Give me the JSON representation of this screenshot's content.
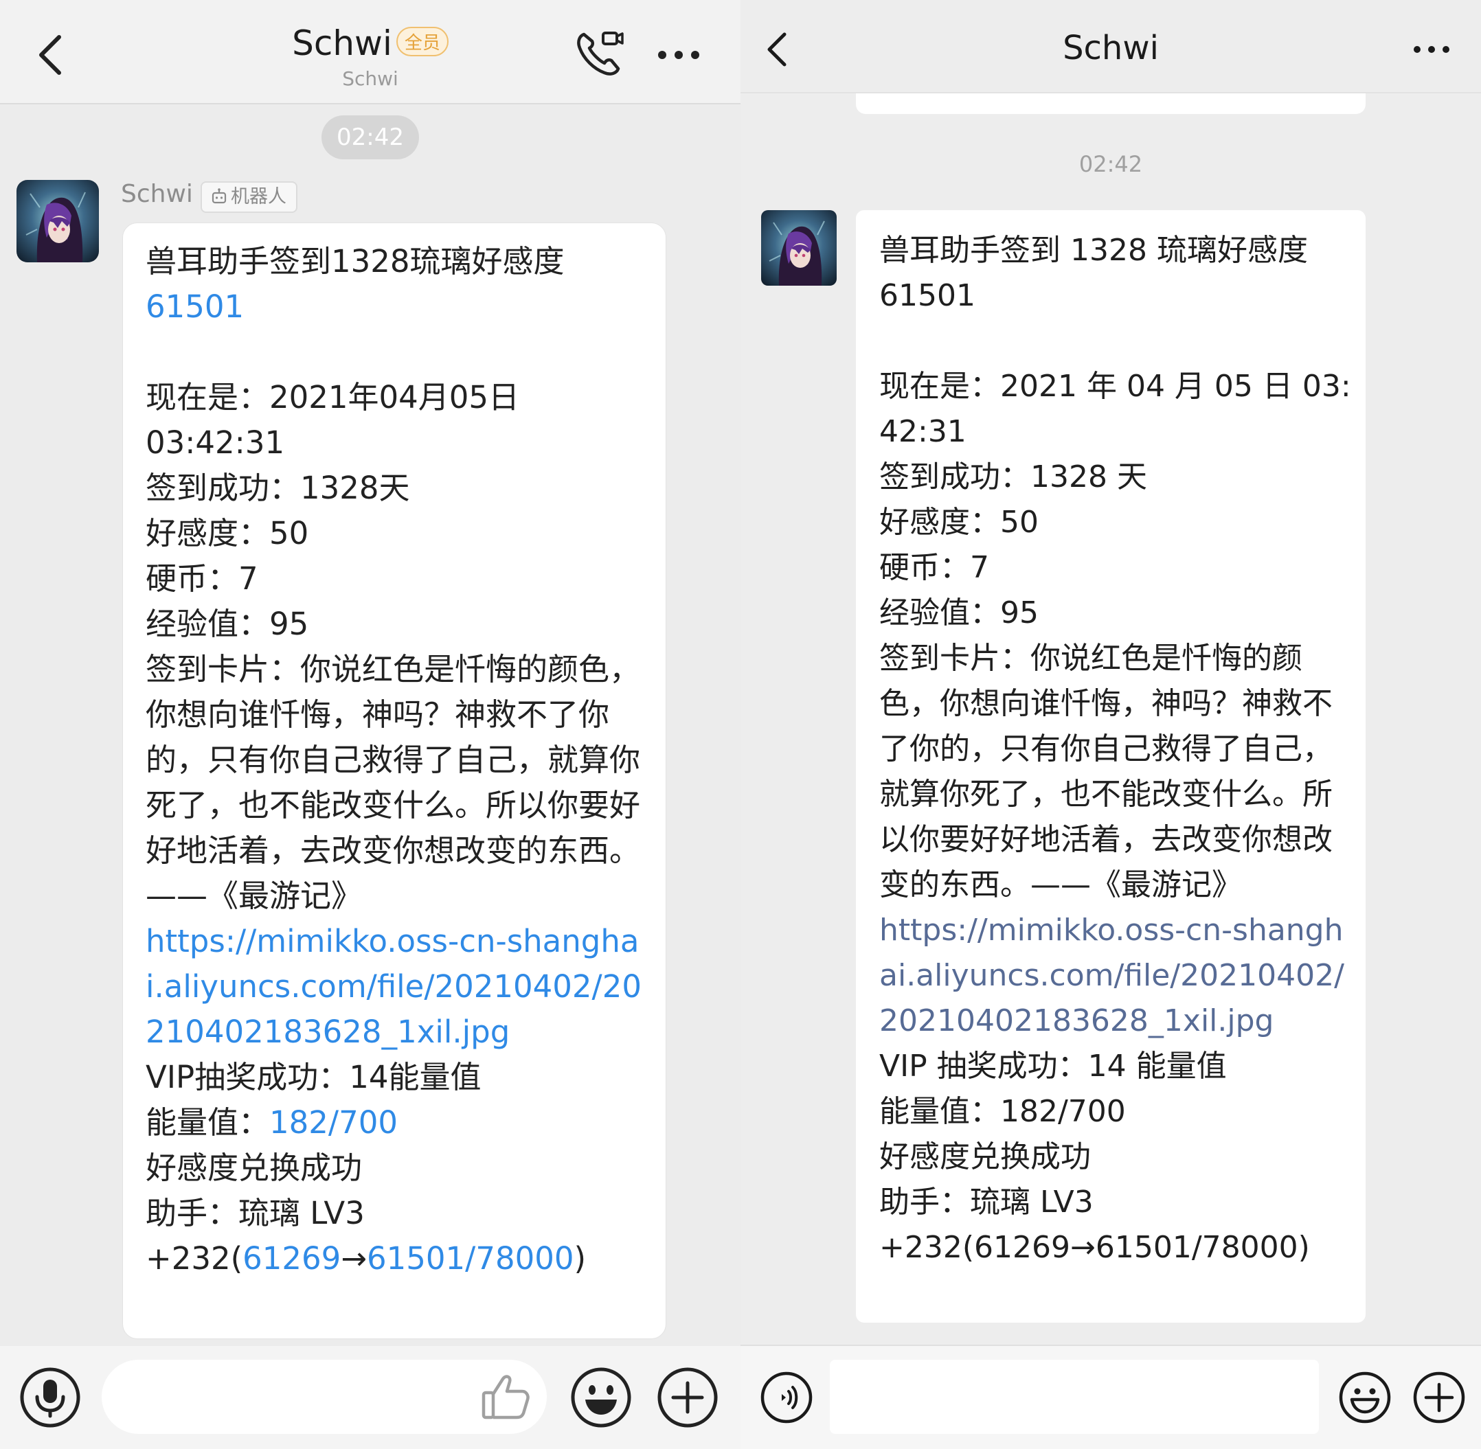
{
  "qq": {
    "title": "Schwi",
    "member_badge": "全员",
    "subtitle": "Schwi",
    "time": "02:42",
    "sender": "Schwi",
    "bot_tag": "机器人",
    "message": {
      "p01": "兽耳助手签到1328琉璃好感度\n",
      "p02": "61501",
      "p03": "\n\n现在是：2021年04月05日\n03:42:31\n签到成功：1328天\n好感度：50\n硬币：7\n经验值：95\n签到卡片：你说红色是忏悔的颜色，你想向谁忏悔，神吗？神救不了你的，只有你自己救得了自己，就算你死了，也不能改变什么。所以你要好好地活着，去改变你想改变的东西。——《最游记》\n",
      "p04": "https://mimikko.oss-cn-shanghai.aliyuncs.com/file/20210402/20210402183628_1xil.jpg",
      "p05": "\nVIP抽奖成功：14能量值\n能量值：",
      "p06": "182/700",
      "p07": "\n好感度兑换成功\n助手：琉璃 LV3\n+232(",
      "p08": "61269",
      "p09": "→",
      "p10": "61501/78000",
      "p11": ")"
    },
    "icons": [
      "back-icon",
      "video-call-icon",
      "more-icon",
      "voice-icon",
      "thumbs-up-icon",
      "emoji-icon",
      "plus-icon"
    ],
    "link_color": "#2f8ae6"
  },
  "wechat": {
    "title": "Schwi",
    "time": "02:42",
    "message": {
      "p01": "兽耳助手签到 1328 琉璃好感度\n61501\n\n现在是：2021 年 04 月 05 日 03:\n42:31\n签到成功：1328 天\n好感度：50\n硬币：7\n经验值：95\n签到卡片：你说红色是忏悔的颜色，你想向谁忏悔，神吗？神救不了你的，只有你自己救得了自己，就算你死了，也不能改变什么。所以你要好好地活着，去改变你想改变的东西。——《最游记》\n",
      "p02": "https://mimikko.oss-cn-shanghai.aliyuncs.com/file/20210402/20210402183628_1xil.jpg",
      "p03": "\nVIP 抽奖成功：14 能量值\n能量值：182/700\n好感度兑换成功\n助手：琉璃 LV3\n+232(61269→61501/78000)"
    },
    "icons": [
      "back-icon",
      "more-icon",
      "voice-icon",
      "emoji-icon",
      "plus-icon"
    ],
    "link_color": "#576b95"
  }
}
